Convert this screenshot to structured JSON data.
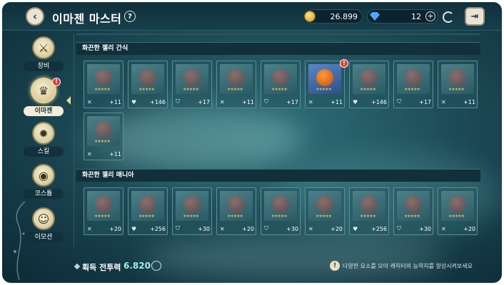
{
  "header": {
    "back_icon": "chevron-left-icon",
    "title": "이마젠 마스터",
    "help_label": "?",
    "gold": "26.899",
    "gems": "12",
    "plus_label": "+",
    "exit_icon": "exit-door-icon"
  },
  "sidebar": {
    "items": [
      {
        "label": "장비",
        "icon": "sword-wrench-icon",
        "glyph": "⚔"
      },
      {
        "label": "이마젠",
        "icon": "crown-icon",
        "glyph": "♛",
        "badge": "!"
      },
      {
        "label": "스킬",
        "icon": "sun-icon",
        "glyph": "✹"
      },
      {
        "label": "코스튬",
        "icon": "mask-icon",
        "glyph": "◉"
      },
      {
        "label": "이모션",
        "icon": "smile-icon",
        "glyph": "☺"
      }
    ]
  },
  "sections": [
    {
      "title": "화끈한 젤리 간식",
      "slots": [
        {
          "icon": "sword",
          "value": "+11"
        },
        {
          "icon": "heart",
          "value": "+146"
        },
        {
          "icon": "shield",
          "value": "+17"
        },
        {
          "icon": "sword",
          "value": "+11"
        },
        {
          "icon": "shield",
          "value": "+17"
        },
        {
          "icon": "sword",
          "value": "+11",
          "owned": true,
          "badge": "!"
        },
        {
          "icon": "heart",
          "value": "+146"
        },
        {
          "icon": "shield",
          "value": "+17"
        },
        {
          "icon": "sword",
          "value": "+11"
        },
        {
          "icon": "sword",
          "value": "+11"
        }
      ]
    },
    {
      "title": "화끈한 젤리 매니아",
      "slots": [
        {
          "icon": "sword",
          "value": "+20"
        },
        {
          "icon": "heart",
          "value": "+256"
        },
        {
          "icon": "shield",
          "value": "+30"
        },
        {
          "icon": "sword",
          "value": "+20"
        },
        {
          "icon": "shield",
          "value": "+30"
        },
        {
          "icon": "sword",
          "value": "+20"
        },
        {
          "icon": "heart",
          "value": "+256"
        },
        {
          "icon": "shield",
          "value": "+30"
        },
        {
          "icon": "sword",
          "value": "+20"
        }
      ]
    }
  ],
  "footer": {
    "power_label": "획득 전투력",
    "power_value": "6.820",
    "tip_text": "다양한 요소를 모아 캐릭터의 능력치를 향상시켜보세요"
  }
}
